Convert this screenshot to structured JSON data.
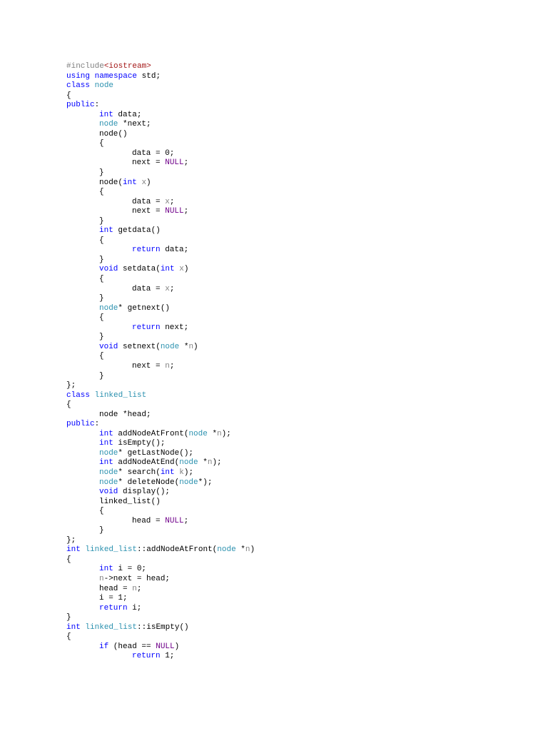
{
  "colors": {
    "keyword": "#0000ff",
    "type": "#2b91af",
    "param": "#808080",
    "macro": "#6f008a",
    "string": "#a31515",
    "preprocessor": "#808080"
  },
  "lines": [
    {
      "indent": 0,
      "tokens": [
        [
          "#include",
          "pp"
        ],
        [
          "<iostream>",
          "s"
        ]
      ]
    },
    {
      "indent": 0,
      "tokens": [
        [
          "using",
          "k"
        ],
        [
          " ",
          "d"
        ],
        [
          "namespace",
          "k"
        ],
        [
          " std;",
          "d"
        ]
      ]
    },
    {
      "indent": 0,
      "tokens": [
        [
          "class",
          "k"
        ],
        [
          " ",
          "d"
        ],
        [
          "node",
          "t"
        ]
      ]
    },
    {
      "indent": 0,
      "tokens": [
        [
          "{",
          "d"
        ]
      ]
    },
    {
      "indent": 0,
      "tokens": [
        [
          "public",
          "k"
        ],
        [
          ":",
          "d"
        ]
      ]
    },
    {
      "indent": 1,
      "tokens": [
        [
          "int",
          "k"
        ],
        [
          " data;",
          "d"
        ]
      ]
    },
    {
      "indent": 1,
      "tokens": [
        [
          "node",
          "t"
        ],
        [
          " *next;",
          "d"
        ]
      ]
    },
    {
      "indent": 1,
      "tokens": [
        [
          "node()",
          "d"
        ]
      ]
    },
    {
      "indent": 1,
      "tokens": [
        [
          "{",
          "d"
        ]
      ]
    },
    {
      "indent": 2,
      "tokens": [
        [
          "data = 0;",
          "d"
        ]
      ]
    },
    {
      "indent": 2,
      "tokens": [
        [
          "next = ",
          "d"
        ],
        [
          "NULL",
          "n"
        ],
        [
          ";",
          "d"
        ]
      ]
    },
    {
      "indent": 1,
      "tokens": [
        [
          "}",
          "d"
        ]
      ]
    },
    {
      "indent": 1,
      "tokens": [
        [
          "node(",
          "d"
        ],
        [
          "int",
          "k"
        ],
        [
          " ",
          "d"
        ],
        [
          "x",
          "p"
        ],
        [
          ")",
          "d"
        ]
      ]
    },
    {
      "indent": 1,
      "tokens": [
        [
          "{",
          "d"
        ]
      ]
    },
    {
      "indent": 2,
      "tokens": [
        [
          "data = ",
          "d"
        ],
        [
          "x",
          "p"
        ],
        [
          ";",
          "d"
        ]
      ]
    },
    {
      "indent": 2,
      "tokens": [
        [
          "next = ",
          "d"
        ],
        [
          "NULL",
          "n"
        ],
        [
          ";",
          "d"
        ]
      ]
    },
    {
      "indent": 1,
      "tokens": [
        [
          "}",
          "d"
        ]
      ]
    },
    {
      "indent": 1,
      "tokens": [
        [
          "int",
          "k"
        ],
        [
          " getdata()",
          "d"
        ]
      ]
    },
    {
      "indent": 1,
      "tokens": [
        [
          "{",
          "d"
        ]
      ]
    },
    {
      "indent": 2,
      "tokens": [
        [
          "return",
          "k"
        ],
        [
          " data;",
          "d"
        ]
      ]
    },
    {
      "indent": 1,
      "tokens": [
        [
          "}",
          "d"
        ]
      ]
    },
    {
      "indent": 1,
      "tokens": [
        [
          "void",
          "k"
        ],
        [
          " setdata(",
          "d"
        ],
        [
          "int",
          "k"
        ],
        [
          " ",
          "d"
        ],
        [
          "x",
          "p"
        ],
        [
          ")",
          "d"
        ]
      ]
    },
    {
      "indent": 1,
      "tokens": [
        [
          "{",
          "d"
        ]
      ]
    },
    {
      "indent": 2,
      "tokens": [
        [
          "data = ",
          "d"
        ],
        [
          "x",
          "p"
        ],
        [
          ";",
          "d"
        ]
      ]
    },
    {
      "indent": 1,
      "tokens": [
        [
          "}",
          "d"
        ]
      ]
    },
    {
      "indent": 1,
      "tokens": [
        [
          "node",
          "t"
        ],
        [
          "* getnext()",
          "d"
        ]
      ]
    },
    {
      "indent": 1,
      "tokens": [
        [
          "{",
          "d"
        ]
      ]
    },
    {
      "indent": 2,
      "tokens": [
        [
          "return",
          "k"
        ],
        [
          " next;",
          "d"
        ]
      ]
    },
    {
      "indent": 1,
      "tokens": [
        [
          "}",
          "d"
        ]
      ]
    },
    {
      "indent": 1,
      "tokens": [
        [
          "void",
          "k"
        ],
        [
          " setnext(",
          "d"
        ],
        [
          "node",
          "t"
        ],
        [
          " *",
          "d"
        ],
        [
          "n",
          "p"
        ],
        [
          ")",
          "d"
        ]
      ]
    },
    {
      "indent": 1,
      "tokens": [
        [
          "{",
          "d"
        ]
      ]
    },
    {
      "indent": 2,
      "tokens": [
        [
          "next = ",
          "d"
        ],
        [
          "n",
          "p"
        ],
        [
          ";",
          "d"
        ]
      ]
    },
    {
      "indent": 1,
      "tokens": [
        [
          "}",
          "d"
        ]
      ]
    },
    {
      "indent": 0,
      "tokens": [
        [
          "};",
          "d"
        ]
      ]
    },
    {
      "indent": 0,
      "tokens": [
        [
          "class",
          "k"
        ],
        [
          " ",
          "d"
        ],
        [
          "linked_list",
          "t"
        ]
      ]
    },
    {
      "indent": 0,
      "tokens": [
        [
          "{",
          "d"
        ]
      ]
    },
    {
      "indent": 1,
      "tokens": [
        [
          "node *head;",
          "d"
        ]
      ]
    },
    {
      "indent": 0,
      "tokens": [
        [
          "public",
          "k"
        ],
        [
          ":",
          "d"
        ]
      ]
    },
    {
      "indent": 1,
      "tokens": [
        [
          "int",
          "k"
        ],
        [
          " addNodeAtFront(",
          "d"
        ],
        [
          "node",
          "t"
        ],
        [
          " *",
          "d"
        ],
        [
          "n",
          "p"
        ],
        [
          ");",
          "d"
        ]
      ]
    },
    {
      "indent": 1,
      "tokens": [
        [
          "int",
          "k"
        ],
        [
          " isEmpty();",
          "d"
        ]
      ]
    },
    {
      "indent": 1,
      "tokens": [
        [
          "node",
          "t"
        ],
        [
          "* getLastNode();",
          "d"
        ]
      ]
    },
    {
      "indent": 1,
      "tokens": [
        [
          "int",
          "k"
        ],
        [
          " addNodeAtEnd(",
          "d"
        ],
        [
          "node",
          "t"
        ],
        [
          " *",
          "d"
        ],
        [
          "n",
          "p"
        ],
        [
          ");",
          "d"
        ]
      ]
    },
    {
      "indent": 1,
      "tokens": [
        [
          "node",
          "t"
        ],
        [
          "* search(",
          "d"
        ],
        [
          "int",
          "k"
        ],
        [
          " ",
          "d"
        ],
        [
          "k",
          "p"
        ],
        [
          ");",
          "d"
        ]
      ]
    },
    {
      "indent": 1,
      "tokens": [
        [
          "node",
          "t"
        ],
        [
          "* deleteNode(",
          "d"
        ],
        [
          "node",
          "t"
        ],
        [
          "*);",
          "d"
        ]
      ]
    },
    {
      "indent": 1,
      "tokens": [
        [
          "void",
          "k"
        ],
        [
          " display();",
          "d"
        ]
      ]
    },
    {
      "indent": 1,
      "tokens": [
        [
          "linked_list()",
          "d"
        ]
      ]
    },
    {
      "indent": 1,
      "tokens": [
        [
          "{",
          "d"
        ]
      ]
    },
    {
      "indent": 2,
      "tokens": [
        [
          "head = ",
          "d"
        ],
        [
          "NULL",
          "n"
        ],
        [
          ";",
          "d"
        ]
      ]
    },
    {
      "indent": 1,
      "tokens": [
        [
          "}",
          "d"
        ]
      ]
    },
    {
      "indent": 0,
      "tokens": [
        [
          "};",
          "d"
        ]
      ]
    },
    {
      "indent": 0,
      "tokens": [
        [
          "int",
          "k"
        ],
        [
          " ",
          "d"
        ],
        [
          "linked_list",
          "t"
        ],
        [
          "::addNodeAtFront(",
          "d"
        ],
        [
          "node",
          "t"
        ],
        [
          " *",
          "d"
        ],
        [
          "n",
          "p"
        ],
        [
          ")",
          "d"
        ]
      ]
    },
    {
      "indent": 0,
      "tokens": [
        [
          "{",
          "d"
        ]
      ]
    },
    {
      "indent": 1,
      "tokens": [
        [
          "int",
          "k"
        ],
        [
          " i = 0;",
          "d"
        ]
      ]
    },
    {
      "indent": 1,
      "tokens": [
        [
          "n",
          "p"
        ],
        [
          "->next = head;",
          "d"
        ]
      ]
    },
    {
      "indent": 1,
      "tokens": [
        [
          "head = ",
          "d"
        ],
        [
          "n",
          "p"
        ],
        [
          ";",
          "d"
        ]
      ]
    },
    {
      "indent": 1,
      "tokens": [
        [
          "i = 1;",
          "d"
        ]
      ]
    },
    {
      "indent": 1,
      "tokens": [
        [
          "return",
          "k"
        ],
        [
          " i;",
          "d"
        ]
      ]
    },
    {
      "indent": 0,
      "tokens": [
        [
          "}",
          "d"
        ]
      ]
    },
    {
      "indent": 0,
      "tokens": [
        [
          "int",
          "k"
        ],
        [
          " ",
          "d"
        ],
        [
          "linked_list",
          "t"
        ],
        [
          "::isEmpty()",
          "d"
        ]
      ]
    },
    {
      "indent": 0,
      "tokens": [
        [
          "{",
          "d"
        ]
      ]
    },
    {
      "indent": 1,
      "tokens": [
        [
          "if",
          "k"
        ],
        [
          " (head == ",
          "d"
        ],
        [
          "NULL",
          "n"
        ],
        [
          ")",
          "d"
        ]
      ]
    },
    {
      "indent": 2,
      "tokens": [
        [
          "return",
          "k"
        ],
        [
          " 1;",
          "d"
        ]
      ]
    }
  ]
}
